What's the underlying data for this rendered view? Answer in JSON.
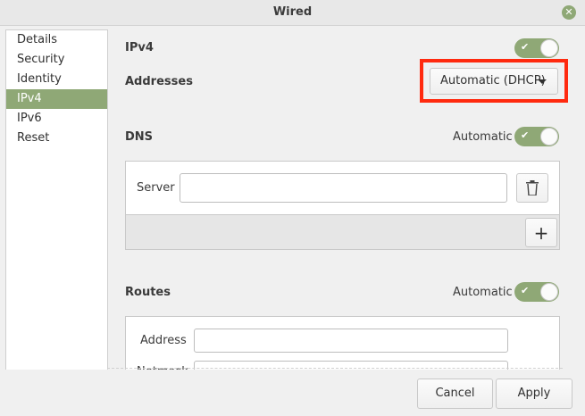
{
  "window": {
    "title": "Wired",
    "close_icon": "close-icon"
  },
  "sidebar": {
    "items": [
      {
        "label": "Details",
        "active": false
      },
      {
        "label": "Security",
        "active": false
      },
      {
        "label": "Identity",
        "active": false
      },
      {
        "label": "IPv4",
        "active": true
      },
      {
        "label": "IPv6",
        "active": false
      },
      {
        "label": "Reset",
        "active": false
      }
    ]
  },
  "ipv4": {
    "label": "IPv4",
    "enabled": true,
    "addresses_label": "Addresses",
    "addresses_method": "Automatic (DHCP)"
  },
  "dns": {
    "label": "DNS",
    "automatic_label": "Automatic",
    "automatic": true,
    "server_label": "Server",
    "server_value": ""
  },
  "routes": {
    "label": "Routes",
    "automatic_label": "Automatic",
    "automatic": true,
    "address_label": "Address",
    "address_value": "",
    "netmask_label": "Netmask"
  },
  "buttons": {
    "cancel": "Cancel",
    "apply": "Apply"
  },
  "colors": {
    "accent": "#8fa876",
    "highlight": "#ff2a0f"
  }
}
